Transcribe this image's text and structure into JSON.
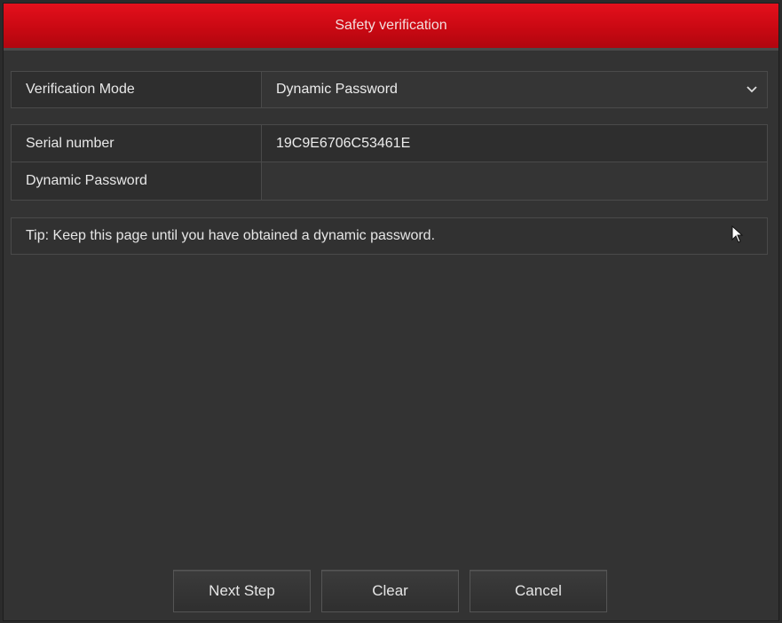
{
  "dialog": {
    "title": "Safety verification"
  },
  "form": {
    "verification_mode": {
      "label": "Verification Mode",
      "selected": "Dynamic Password",
      "icon": "chevron-down-icon"
    },
    "serial_number": {
      "label": "Serial number",
      "value": "19C9E6706C53461E"
    },
    "dynamic_password": {
      "label": "Dynamic Password",
      "value": ""
    }
  },
  "tip": "Tip: Keep this page until you have obtained a dynamic password.",
  "buttons": {
    "next": "Next Step",
    "clear": "Clear",
    "cancel": "Cancel"
  },
  "colors": {
    "titlebar": "#d00a14",
    "background": "#333333"
  }
}
